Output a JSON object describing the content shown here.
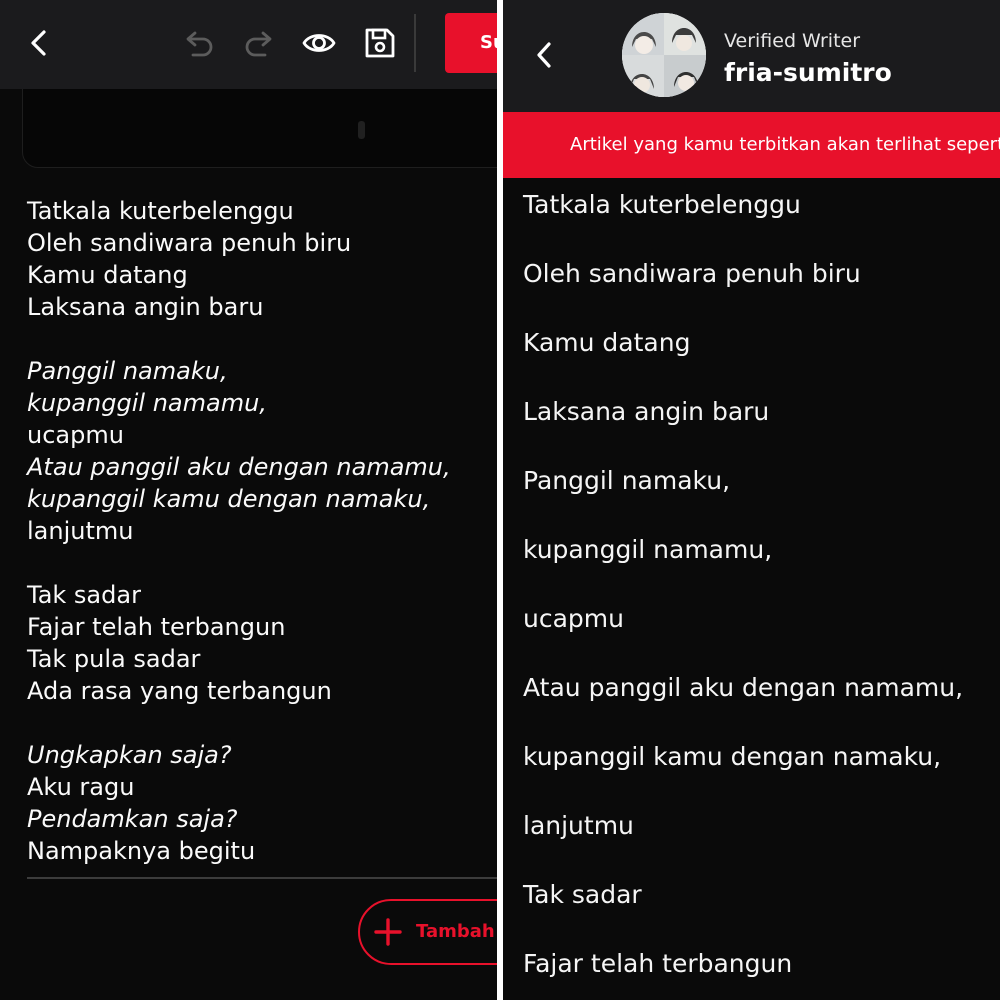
{
  "editor": {
    "toolbar": {
      "back_icon": "chevron-left-icon",
      "undo_icon": "undo-icon",
      "redo_icon": "redo-icon",
      "preview_icon": "eye-icon",
      "save_icon": "floppy-disk-icon",
      "submit_label": "Su"
    },
    "stanzas": [
      [
        {
          "text": "Tatkala kuterbelenggu",
          "italic": false
        },
        {
          "text": "Oleh sandiwara penuh biru",
          "italic": false
        },
        {
          "text": "Kamu datang",
          "italic": false
        },
        {
          "text": "Laksana angin baru",
          "italic": false
        }
      ],
      [
        {
          "text": "Panggil namaku,",
          "italic": true
        },
        {
          "text": "kupanggil namamu,",
          "italic": true
        },
        {
          "text": "ucapmu",
          "italic": false
        },
        {
          "text": "Atau panggil aku dengan namamu,",
          "italic": true
        },
        {
          "text": "kupanggil kamu dengan namaku,",
          "italic": true
        },
        {
          "text": "lanjutmu",
          "italic": false
        }
      ],
      [
        {
          "text": "Tak sadar",
          "italic": false
        },
        {
          "text": "Fajar telah terbangun",
          "italic": false
        },
        {
          "text": "Tak pula sadar",
          "italic": false
        },
        {
          "text": "Ada rasa yang terbangun",
          "italic": false
        }
      ],
      [
        {
          "text": "Ungkapkan saja?",
          "italic": true
        },
        {
          "text": "Aku ragu",
          "italic": false
        },
        {
          "text": "Pendamkan saja?",
          "italic": true
        },
        {
          "text": "Nampaknya begitu",
          "italic": false
        }
      ]
    ],
    "add_section_icon": "plus-icon",
    "add_section_label": "Tambah S"
  },
  "preview": {
    "back_icon": "chevron-left-icon",
    "author_badge": "Verified Writer",
    "author_name": "fria-sumitro",
    "banner_text": "Artikel yang kamu terbitkan akan terlihat seperti i",
    "lines": [
      "Tatkala kuterbelenggu",
      "Oleh sandiwara penuh biru",
      "Kamu datang",
      "Laksana angin baru",
      "Panggil namaku,",
      "kupanggil namamu,",
      "ucapmu",
      "Atau panggil aku dengan namamu,",
      "kupanggil kamu dengan namaku,",
      "lanjutmu",
      "Tak sadar",
      "Fajar telah terbangun"
    ]
  },
  "colors": {
    "accent": "#e8112b",
    "background": "#0a0a0a",
    "header": "#1b1b1d",
    "text": "#ffffff"
  }
}
